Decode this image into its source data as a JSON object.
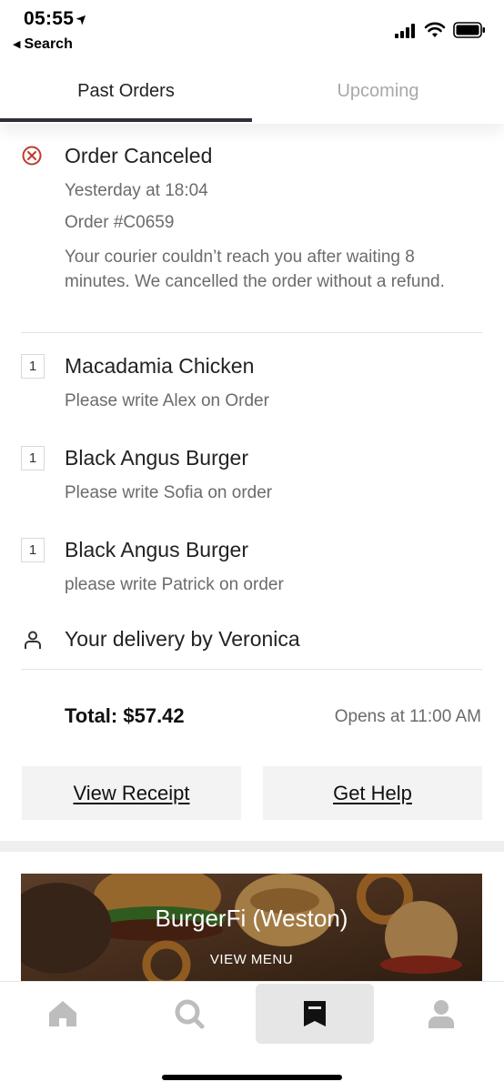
{
  "status_bar": {
    "time": "05:55",
    "back_label": "Search"
  },
  "tabs": [
    {
      "label": "Past Orders",
      "active": true
    },
    {
      "label": "Upcoming",
      "active": false
    }
  ],
  "order": {
    "status": "Order Canceled",
    "time": "Yesterday at 18:04",
    "number": "Order #C0659",
    "message": "Your courier couldn’t reach you after waiting 8 minutes. We cancelled the order without a refund.",
    "items": [
      {
        "qty": "1",
        "name": "Macadamia Chicken",
        "note": "Please write  Alex on Order"
      },
      {
        "qty": "1",
        "name": "Black Angus Burger",
        "note": "Please write Sofia on order"
      },
      {
        "qty": "1",
        "name": "Black Angus Burger",
        "note": "please write Patrick on order"
      }
    ],
    "delivery": "Your delivery by Veronica",
    "total": "Total: $57.42",
    "opens": "Opens at 11:00 AM"
  },
  "actions": {
    "view_receipt": "View Receipt",
    "get_help": "Get Help"
  },
  "restaurant": {
    "name": "BurgerFi (Weston)",
    "cta": "VIEW MENU"
  },
  "bottom_nav": [
    {
      "icon": "home-icon",
      "active": false
    },
    {
      "icon": "search-icon",
      "active": false
    },
    {
      "icon": "orders-icon",
      "active": true
    },
    {
      "icon": "account-icon",
      "active": false
    }
  ],
  "colors": {
    "cancel_red": "#c0392b",
    "tab_underline": "#2d2f3a",
    "muted_text": "#6b6b6b"
  }
}
